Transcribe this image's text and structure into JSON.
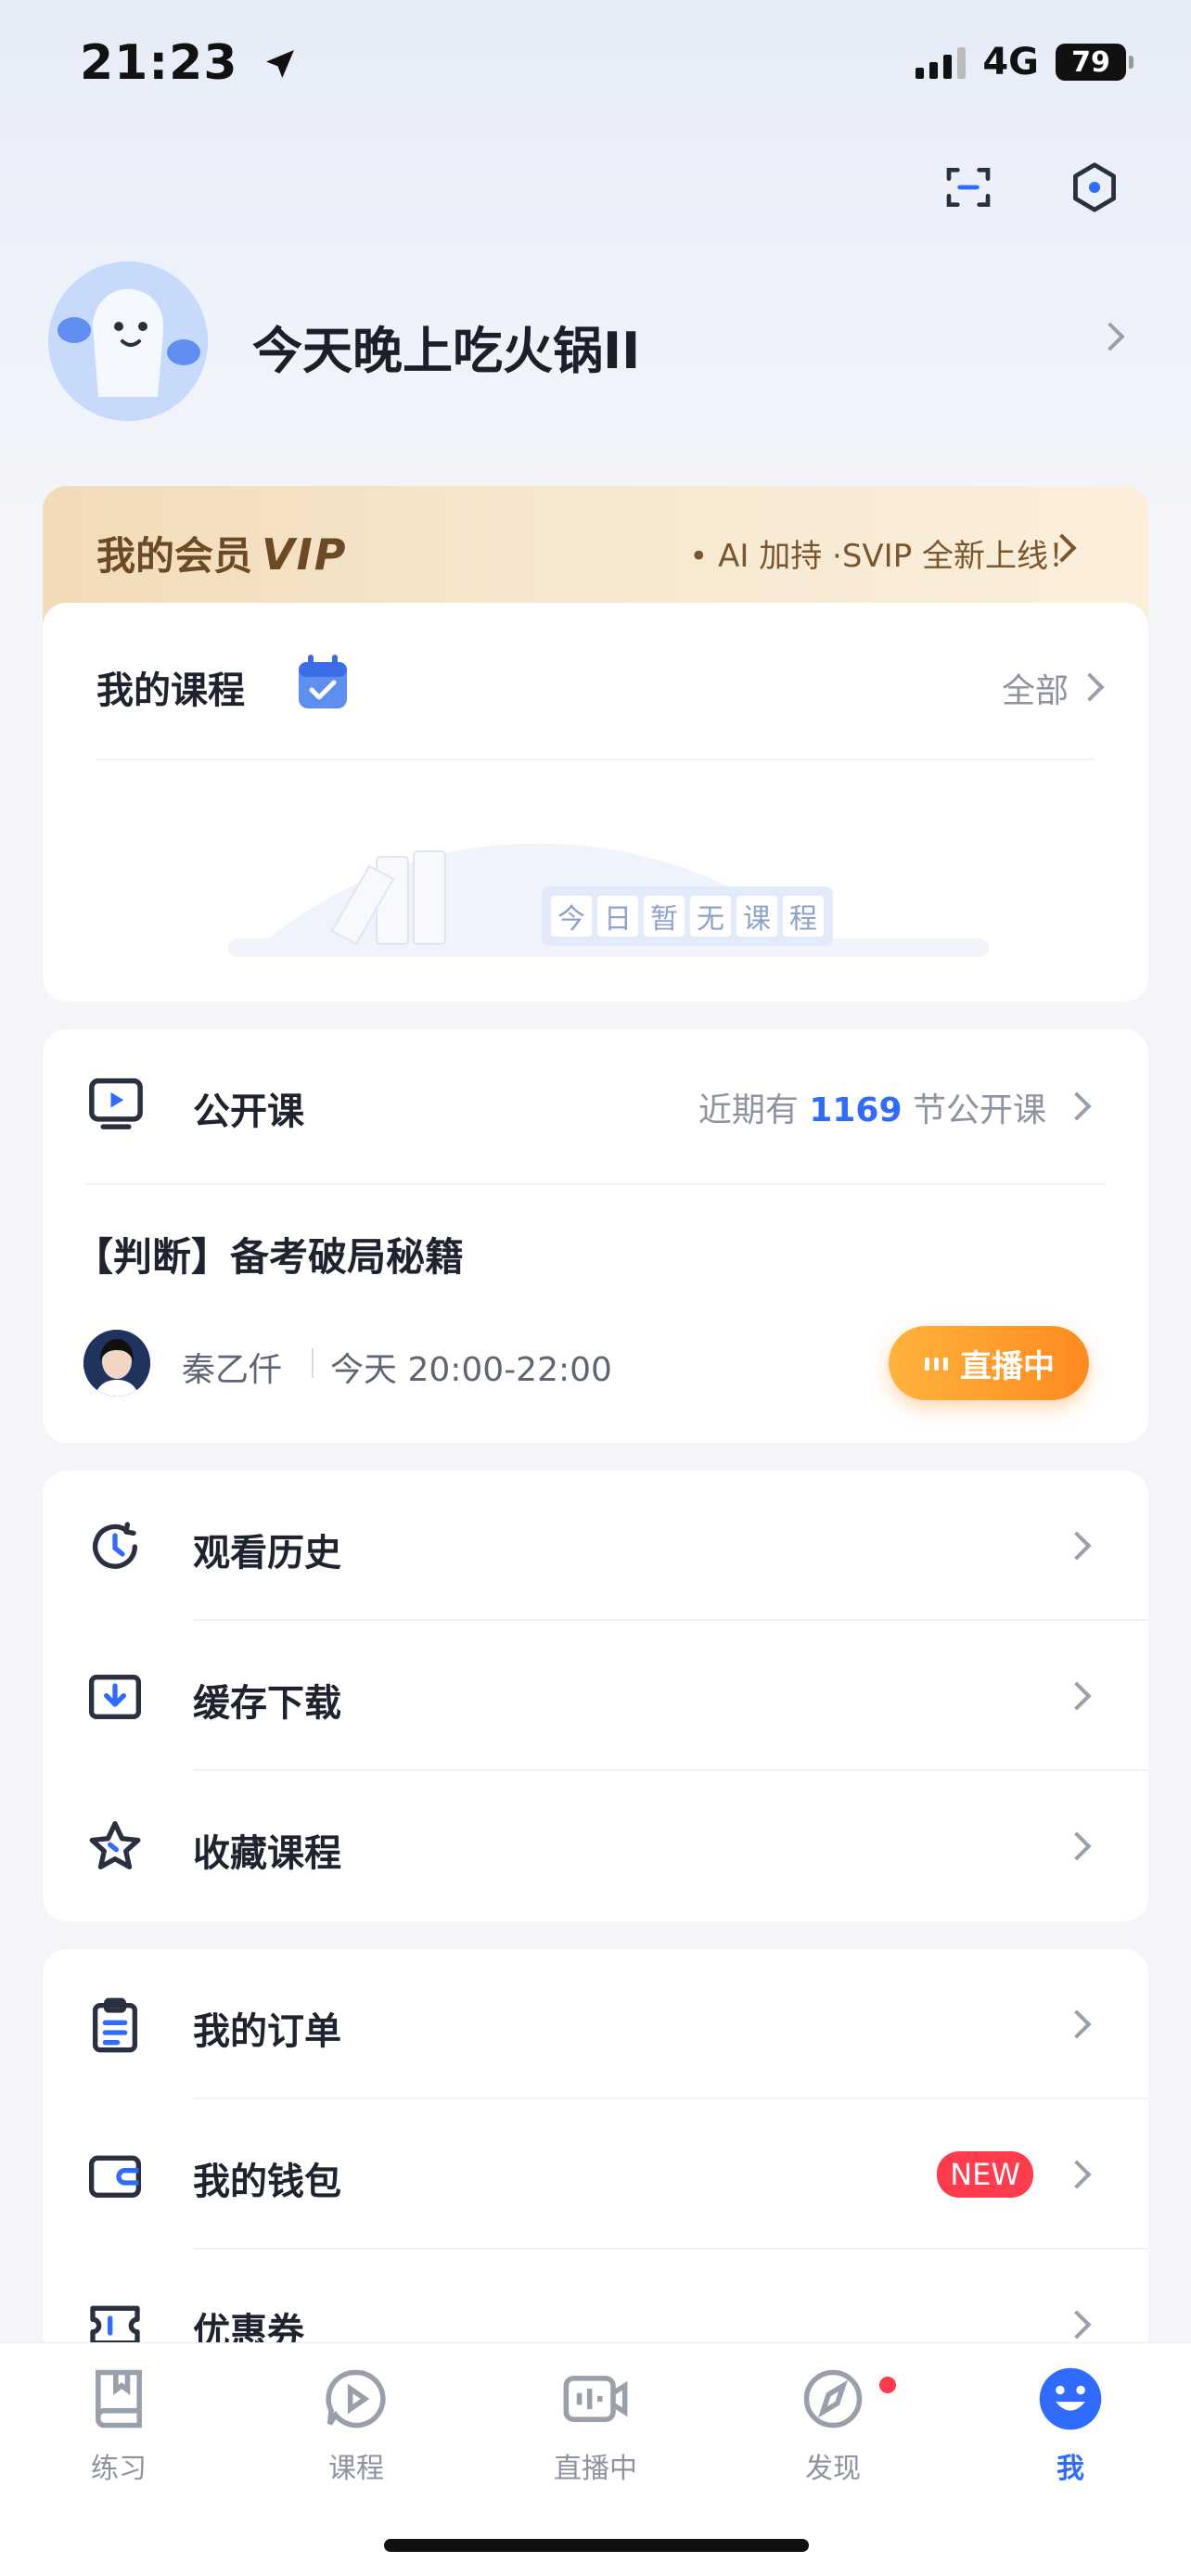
{
  "status_bar": {
    "time": "21:23",
    "network": "4G",
    "battery": "79"
  },
  "profile": {
    "username": "今天晚上吃火锅II"
  },
  "vip": {
    "title": "我的会员",
    "badge": "VIP",
    "promo": "• AI 加持 ·SVIP 全新上线！"
  },
  "my_courses": {
    "title": "我的课程",
    "all_label": "全部",
    "empty_chars": [
      "今",
      "日",
      "暂",
      "无",
      "课",
      "程"
    ]
  },
  "open_class": {
    "title": "公开课",
    "count_prefix": "近期有",
    "count": "1169",
    "count_suffix": "节公开课",
    "lesson_title": "【判断】备考破局秘籍",
    "teacher": "秦乙仟",
    "time": "今天 20:00-22:00",
    "live_label": "直播中"
  },
  "menu_group_1": [
    {
      "label": "观看历史",
      "icon": "clock-icon"
    },
    {
      "label": "缓存下载",
      "icon": "download-icon"
    },
    {
      "label": "收藏课程",
      "icon": "star-icon"
    }
  ],
  "menu_group_2": [
    {
      "label": "我的订单",
      "icon": "clipboard-icon"
    },
    {
      "label": "我的钱包",
      "icon": "wallet-icon",
      "badge": "NEW"
    },
    {
      "label": "优惠券",
      "icon": "coupon-icon"
    }
  ],
  "tabs": [
    {
      "label": "练习",
      "icon": "book-icon"
    },
    {
      "label": "课程",
      "icon": "play-bubble-icon"
    },
    {
      "label": "直播中",
      "icon": "live-video-icon"
    },
    {
      "label": "发现",
      "icon": "compass-icon"
    },
    {
      "label": "我",
      "icon": "smiley-icon",
      "active": true
    }
  ],
  "colors": {
    "accent": "#2f6bff",
    "live": "#ff8a1f",
    "badge": "#ff3b4e",
    "vip_text": "#6b4a24"
  }
}
